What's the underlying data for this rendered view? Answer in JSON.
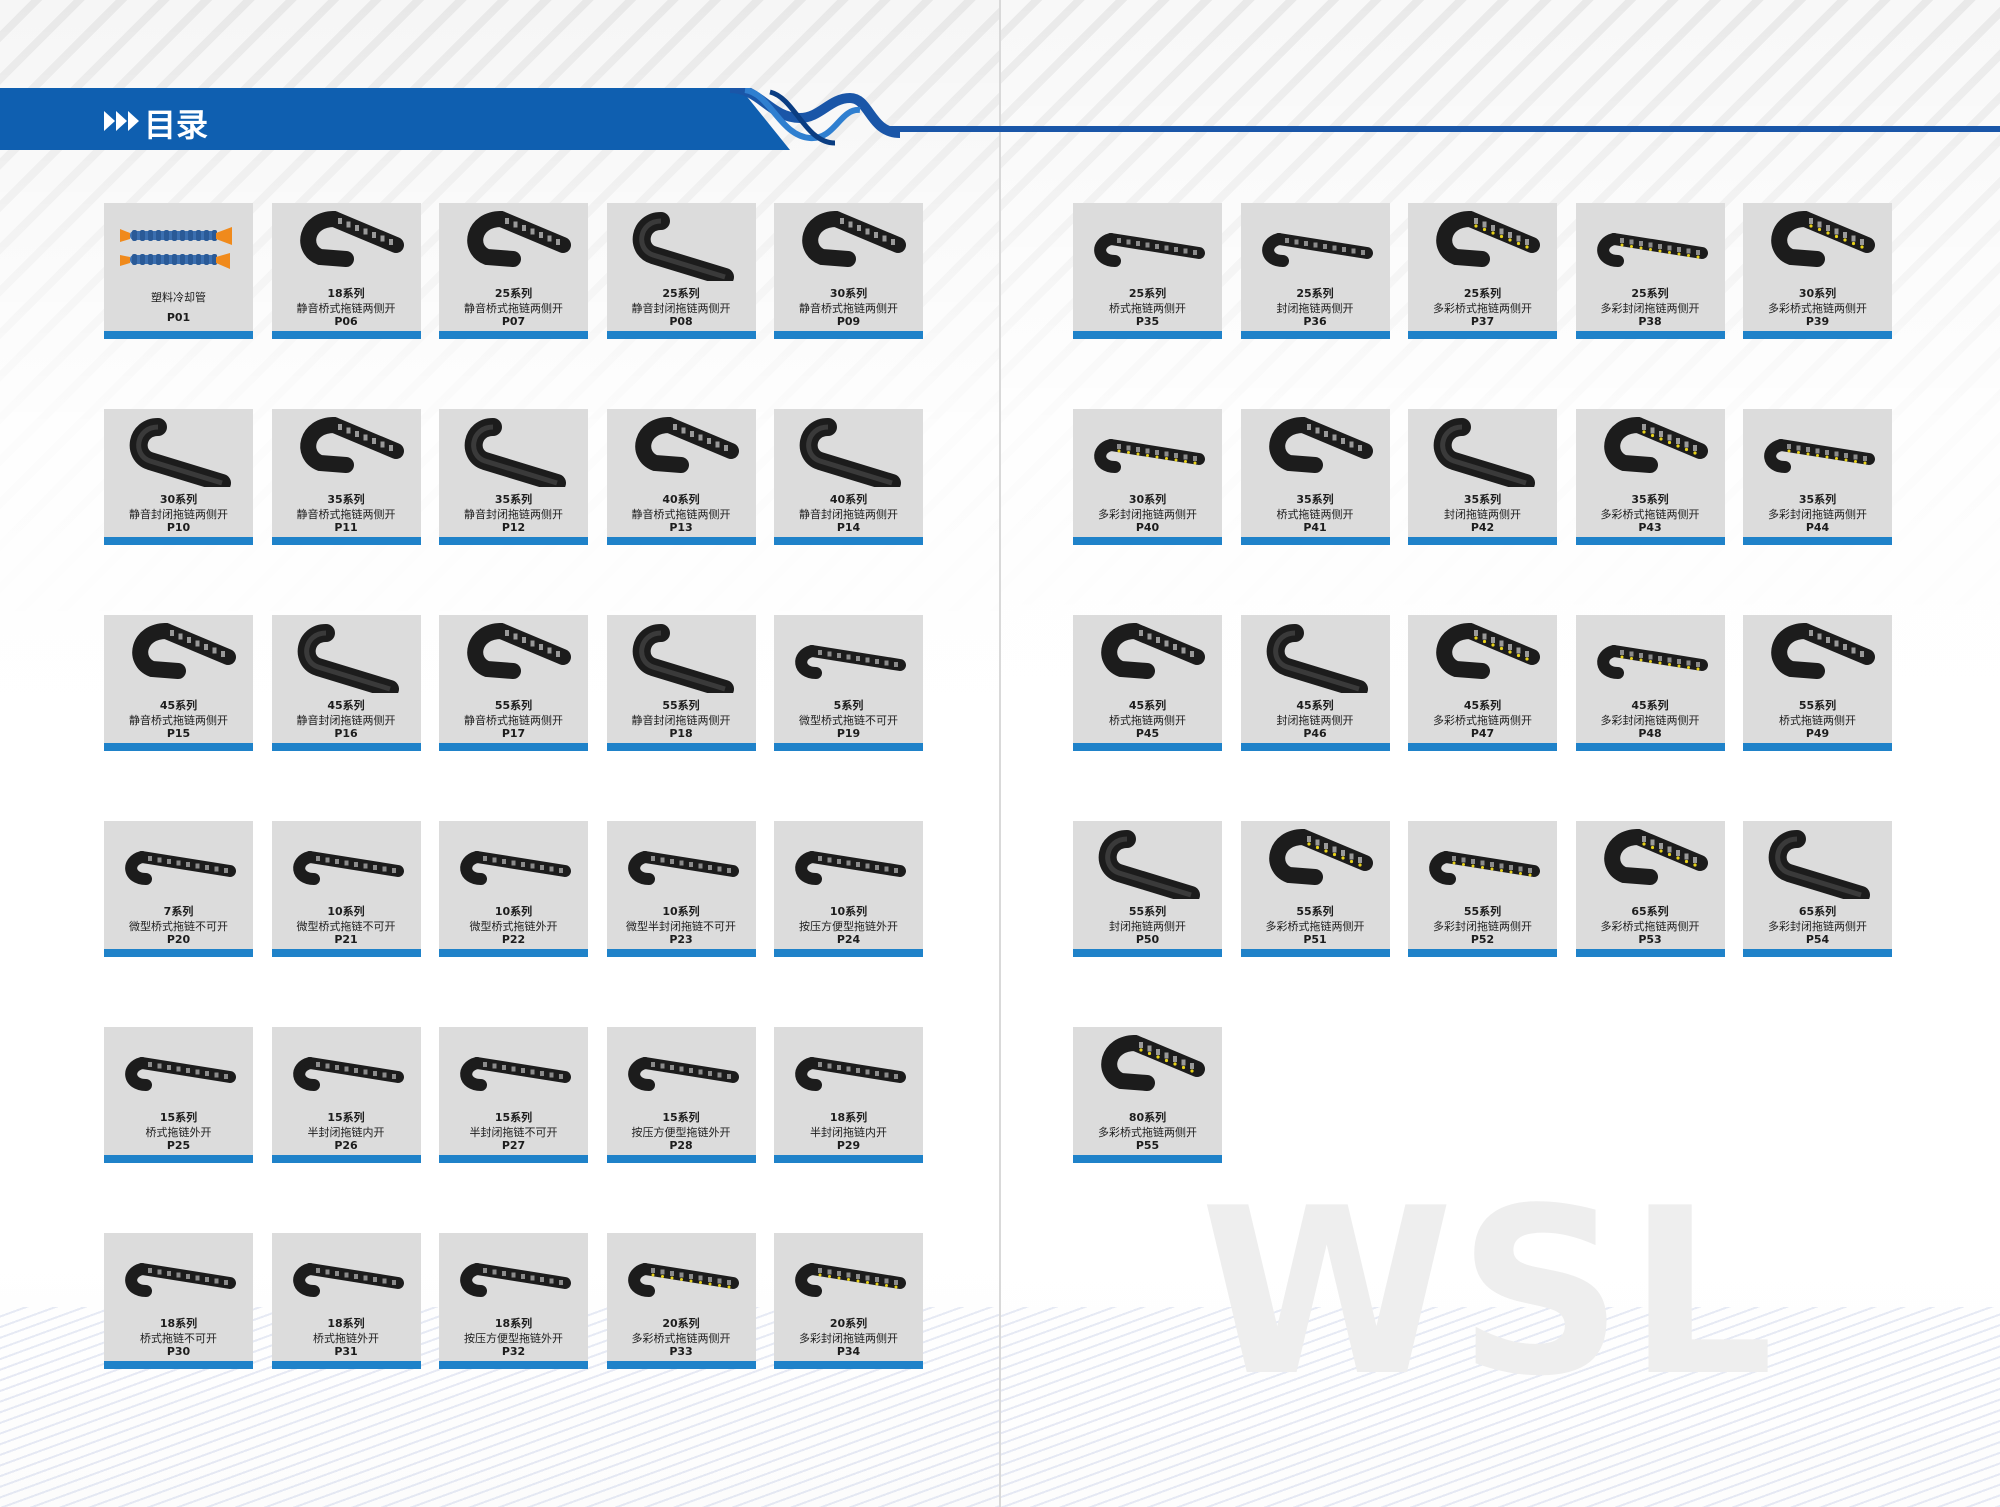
{
  "header": {
    "title": "目录"
  },
  "watermark": "WSL",
  "colors": {
    "brand_blue": "#0f5fb0",
    "card_bar": "#1f82c9",
    "card_bg": "#dcdcdc"
  },
  "left_items": [
    {
      "series": "",
      "desc": "塑料冷却管",
      "page": "P01",
      "icon": "coolant-pipe-icon"
    },
    {
      "series": "18系列",
      "desc": "静音桥式拖链两侧开",
      "page": "P06",
      "icon": "bridge-drag-chain-icon"
    },
    {
      "series": "25系列",
      "desc": "静音桥式拖链两侧开",
      "page": "P07",
      "icon": "bridge-drag-chain-icon"
    },
    {
      "series": "25系列",
      "desc": "静音封闭拖链两侧开",
      "page": "P08",
      "icon": "enclosed-drag-chain-icon"
    },
    {
      "series": "30系列",
      "desc": "静音桥式拖链两侧开",
      "page": "P09",
      "icon": "bridge-drag-chain-icon"
    },
    {
      "series": "30系列",
      "desc": "静音封闭拖链两侧开",
      "page": "P10",
      "icon": "enclosed-drag-chain-icon"
    },
    {
      "series": "35系列",
      "desc": "静音桥式拖链两侧开",
      "page": "P11",
      "icon": "bridge-drag-chain-icon"
    },
    {
      "series": "35系列",
      "desc": "静音封闭拖链两侧开",
      "page": "P12",
      "icon": "enclosed-drag-chain-icon"
    },
    {
      "series": "40系列",
      "desc": "静音桥式拖链两侧开",
      "page": "P13",
      "icon": "bridge-drag-chain-icon"
    },
    {
      "series": "40系列",
      "desc": "静音封闭拖链两侧开",
      "page": "P14",
      "icon": "enclosed-drag-chain-icon"
    },
    {
      "series": "45系列",
      "desc": "静音桥式拖链两侧开",
      "page": "P15",
      "icon": "bridge-drag-chain-icon"
    },
    {
      "series": "45系列",
      "desc": "静音封闭拖链两侧开",
      "page": "P16",
      "icon": "enclosed-drag-chain-icon"
    },
    {
      "series": "55系列",
      "desc": "静音桥式拖链两侧开",
      "page": "P17",
      "icon": "bridge-drag-chain-icon"
    },
    {
      "series": "55系列",
      "desc": "静音封闭拖链两侧开",
      "page": "P18",
      "icon": "enclosed-drag-chain-icon"
    },
    {
      "series": "5系列",
      "desc": "微型桥式拖链不可开",
      "page": "P19",
      "icon": "straight-drag-chain-icon"
    },
    {
      "series": "7系列",
      "desc": "微型桥式拖链不可开",
      "page": "P20",
      "icon": "straight-drag-chain-icon"
    },
    {
      "series": "10系列",
      "desc": "微型桥式拖链不可开",
      "page": "P21",
      "icon": "straight-drag-chain-icon"
    },
    {
      "series": "10系列",
      "desc": "微型桥式拖链外开",
      "page": "P22",
      "icon": "straight-drag-chain-icon"
    },
    {
      "series": "10系列",
      "desc": "微型半封闭拖链不可开",
      "page": "P23",
      "icon": "straight-drag-chain-icon"
    },
    {
      "series": "10系列",
      "desc": "按压方便型拖链外开",
      "page": "P24",
      "icon": "straight-drag-chain-icon"
    },
    {
      "series": "15系列",
      "desc": "桥式拖链外开",
      "page": "P25",
      "icon": "straight-drag-chain-icon"
    },
    {
      "series": "15系列",
      "desc": "半封闭拖链内开",
      "page": "P26",
      "icon": "straight-drag-chain-icon"
    },
    {
      "series": "15系列",
      "desc": "半封闭拖链不可开",
      "page": "P27",
      "icon": "straight-drag-chain-icon"
    },
    {
      "series": "15系列",
      "desc": "按压方便型拖链外开",
      "page": "P28",
      "icon": "straight-drag-chain-icon"
    },
    {
      "series": "18系列",
      "desc": "半封闭拖链内开",
      "page": "P29",
      "icon": "straight-drag-chain-icon"
    },
    {
      "series": "18系列",
      "desc": "桥式拖链不可开",
      "page": "P30",
      "icon": "straight-drag-chain-icon"
    },
    {
      "series": "18系列",
      "desc": "桥式拖链外开",
      "page": "P31",
      "icon": "straight-drag-chain-icon"
    },
    {
      "series": "18系列",
      "desc": "按压方便型拖链外开",
      "page": "P32",
      "icon": "straight-drag-chain-icon"
    },
    {
      "series": "20系列",
      "desc": "多彩桥式拖链两侧开",
      "page": "P33",
      "icon": "straight-drag-chain-icon"
    },
    {
      "series": "20系列",
      "desc": "多彩封闭拖链两侧开",
      "page": "P34",
      "icon": "straight-drag-chain-icon"
    }
  ],
  "right_items": [
    {
      "series": "25系列",
      "desc": "桥式拖链两侧开",
      "page": "P35",
      "icon": "straight-drag-chain-icon"
    },
    {
      "series": "25系列",
      "desc": "封闭拖链两侧开",
      "page": "P36",
      "icon": "straight-drag-chain-icon"
    },
    {
      "series": "25系列",
      "desc": "多彩桥式拖链两侧开",
      "page": "P37",
      "icon": "bridge-drag-chain-icon"
    },
    {
      "series": "25系列",
      "desc": "多彩封闭拖链两侧开",
      "page": "P38",
      "icon": "straight-drag-chain-icon"
    },
    {
      "series": "30系列",
      "desc": "多彩桥式拖链两侧开",
      "page": "P39",
      "icon": "bridge-drag-chain-icon"
    },
    {
      "series": "30系列",
      "desc": "多彩封闭拖链两侧开",
      "page": "P40",
      "icon": "straight-drag-chain-icon"
    },
    {
      "series": "35系列",
      "desc": "桥式拖链两侧开",
      "page": "P41",
      "icon": "bridge-drag-chain-icon"
    },
    {
      "series": "35系列",
      "desc": "封闭拖链两侧开",
      "page": "P42",
      "icon": "enclosed-drag-chain-icon"
    },
    {
      "series": "35系列",
      "desc": "多彩桥式拖链两侧开",
      "page": "P43",
      "icon": "bridge-drag-chain-icon"
    },
    {
      "series": "35系列",
      "desc": "多彩封闭拖链两侧开",
      "page": "P44",
      "icon": "straight-drag-chain-icon"
    },
    {
      "series": "45系列",
      "desc": "桥式拖链两侧开",
      "page": "P45",
      "icon": "bridge-drag-chain-icon"
    },
    {
      "series": "45系列",
      "desc": "封闭拖链两侧开",
      "page": "P46",
      "icon": "enclosed-drag-chain-icon"
    },
    {
      "series": "45系列",
      "desc": "多彩桥式拖链两侧开",
      "page": "P47",
      "icon": "bridge-drag-chain-icon"
    },
    {
      "series": "45系列",
      "desc": "多彩封闭拖链两侧开",
      "page": "P48",
      "icon": "straight-drag-chain-icon"
    },
    {
      "series": "55系列",
      "desc": "桥式拖链两侧开",
      "page": "P49",
      "icon": "bridge-drag-chain-icon"
    },
    {
      "series": "55系列",
      "desc": "封闭拖链两侧开",
      "page": "P50",
      "icon": "enclosed-drag-chain-icon"
    },
    {
      "series": "55系列",
      "desc": "多彩桥式拖链两侧开",
      "page": "P51",
      "icon": "bridge-drag-chain-icon"
    },
    {
      "series": "55系列",
      "desc": "多彩封闭拖链两侧开",
      "page": "P52",
      "icon": "straight-drag-chain-icon"
    },
    {
      "series": "65系列",
      "desc": "多彩桥式拖链两侧开",
      "page": "P53",
      "icon": "bridge-drag-chain-icon"
    },
    {
      "series": "65系列",
      "desc": "多彩封闭拖链两侧开",
      "page": "P54",
      "icon": "enclosed-drag-chain-icon"
    },
    {
      "series": "80系列",
      "desc": "多彩桥式拖链两侧开",
      "page": "P55",
      "icon": "bridge-drag-chain-icon"
    }
  ]
}
